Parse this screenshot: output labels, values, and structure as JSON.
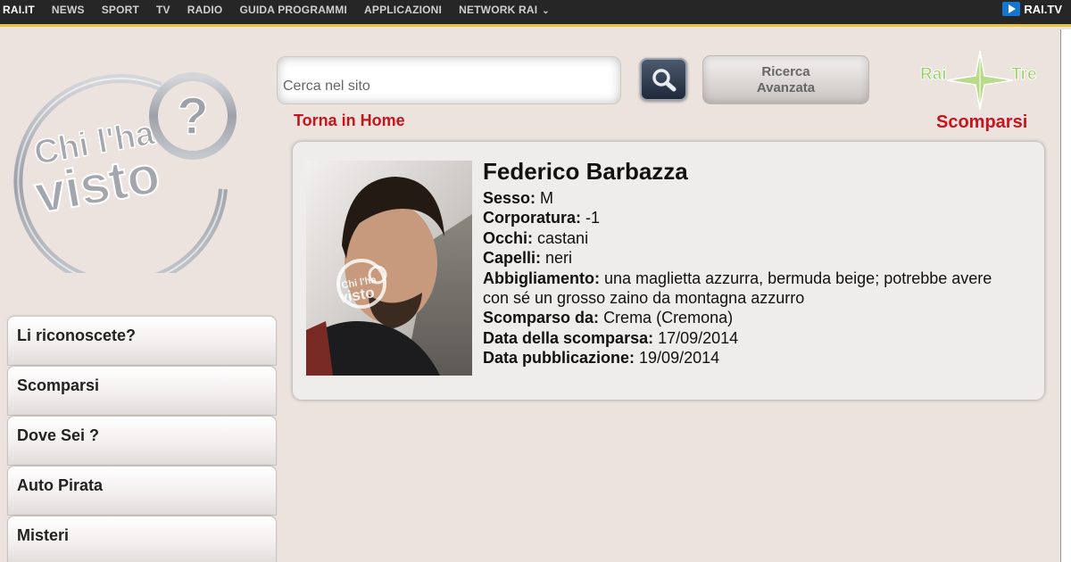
{
  "topnav": {
    "items": [
      "RAI.IT",
      "NEWS",
      "SPORT",
      "TV",
      "RADIO",
      "GUIDA PROGRAMMI",
      "APPLICAZIONI",
      "NETWORK RAI"
    ],
    "raitv_label": "RAI.TV"
  },
  "logo": {
    "line1": "Chi l'ha",
    "line2": "visto",
    "mark": "?"
  },
  "search": {
    "placeholder": "Cerca nel sito",
    "advanced_line1": "Ricerca",
    "advanced_line2": "Avanzata"
  },
  "home_link": "Torna in Home",
  "channel": {
    "rai": "Rai",
    "tre": "Tre"
  },
  "section_title": "Scomparsi",
  "menu": {
    "items": [
      "Li riconoscete?",
      "Scomparsi",
      "Dove Sei ?",
      "Auto Pirata",
      "Misteri"
    ]
  },
  "person": {
    "name": "Federico Barbazza",
    "fields": [
      {
        "label": "Sesso:",
        "value": "M"
      },
      {
        "label": "Corporatura:",
        "value": "-1"
      },
      {
        "label": "Occhi:",
        "value": "castani"
      },
      {
        "label": "Capelli:",
        "value": "neri"
      },
      {
        "label": "Abbigliamento:",
        "value": "una maglietta azzurra, bermuda beige; potrebbe avere con sé un grosso zaino da montagna azzurro"
      },
      {
        "label": "Scomparso da:",
        "value": "Crema (Cremona)"
      },
      {
        "label": "Data della scomparsa:",
        "value": "17/09/2014"
      },
      {
        "label": "Data pubblicazione:",
        "value": "19/09/2014"
      }
    ],
    "watermark_line1": "Chi l'ha",
    "watermark_line2": "visto"
  },
  "colors": {
    "accent_red": "#c8141b",
    "topbar": "#262626",
    "topbar_border": "#e9c33a",
    "background": "#ece3df"
  }
}
